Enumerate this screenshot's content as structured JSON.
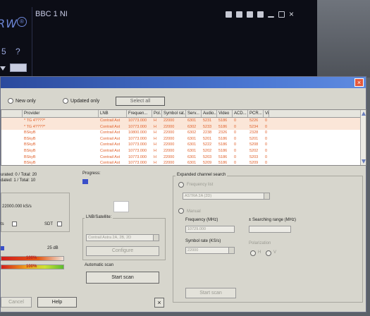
{
  "player": {
    "logo_text": "RW",
    "logo_badge": "®",
    "channel": "BBC 1 NI",
    "num_label": "5",
    "help_label": "?",
    "close_glyph": "×"
  },
  "dialog": {
    "close_glyph": "×",
    "filters": {
      "new_only": "New only",
      "updated_only": "Updated only",
      "select_all": "Select all"
    },
    "table": {
      "columns": [
        "",
        "Provider",
        "LNB",
        "Frequen...",
        "Pol.",
        "Symbol rat...",
        "Serv...",
        "Audio...",
        "Video",
        "ACD...",
        "PCR...",
        "Vid"
      ],
      "rows": [
        [
          "",
          "* TG 4????*",
          "Contrail Ast",
          "10773.000",
          "H",
          "22000",
          "6301",
          "5231",
          "5186",
          "0",
          "5226",
          "0"
        ],
        [
          "",
          "* TG 4????*",
          "Contrail Ast",
          "10773.000",
          "H",
          "22000",
          "6302",
          "5233",
          "5186",
          "0",
          "5234",
          "0"
        ],
        [
          "",
          "BSkyB",
          "Contrail Ast",
          "10800.000",
          "H",
          "22000",
          "6302",
          "2238",
          "2326",
          "0",
          "2328",
          "0"
        ],
        [
          "",
          "BSkyB",
          "Contrail Ast",
          "10773.000",
          "H",
          "22000",
          "6301",
          "5201",
          "5186",
          "0",
          "5201",
          "0"
        ],
        [
          "",
          "BSkyB",
          "Contrail Ast",
          "10773.000",
          "H",
          "22000",
          "6301",
          "5222",
          "5186",
          "0",
          "5208",
          "0"
        ],
        [
          "",
          "BSkyB",
          "Contrail Ast",
          "10773.000",
          "H",
          "22000",
          "6301",
          "5202",
          "5186",
          "0",
          "5202",
          "0"
        ],
        [
          "",
          "BSkyB",
          "Contrail Ast",
          "10773.000",
          "H",
          "22000",
          "6301",
          "5203",
          "5186",
          "0",
          "5203",
          "0"
        ],
        [
          "",
          "BSkyB",
          "Contrail Ast",
          "10773.000",
          "H",
          "22000",
          "6301",
          "5209",
          "5186",
          "0",
          "5209",
          "0"
        ]
      ]
    },
    "left_panel": {
      "line1": "urated: 0 / Total: 20",
      "line2": "dated: 1 / Total: 10",
      "symbol_rate": "22000.000 kS/s",
      "cb1": "ts",
      "cb2": "SDT",
      "signal_value": "25 dB",
      "quality_value": "100%",
      "level_value": "100%",
      "cancel_label": "Cancel",
      "help_label": "Help"
    },
    "middle_panel": {
      "progress_label": "Progress:",
      "lnb_label": "LNB/Satellite:",
      "lnb_value": "Contrail Astra 2A, 2B, 2D",
      "configure_label": "Configure",
      "auto_scan_label": "Automatic scan",
      "start_scan_label": "Start scan",
      "close_glyph": "×"
    },
    "right_panel": {
      "title": "Expanded channel search",
      "opt_predefined": "Frequency list",
      "predefined_value": "ASTRA 2A (2D)",
      "opt_manual": "Manual",
      "frequency_label": "Frequency (MHz)",
      "frequency_value": "10729.000",
      "search_range_label": "± Searching range (MHz)",
      "symbol_rate_label": "Symbol rate (KS/s)",
      "symbol_rate_value": "22000",
      "polarization_label": "Polarization",
      "pol_h": "H",
      "pol_v": "V",
      "start_scan_label": "Start scan"
    }
  },
  "colors": {
    "table_text": "#e0602a",
    "titlebar": "#2b4a9d",
    "signal_bar": "#3a4fc9"
  }
}
